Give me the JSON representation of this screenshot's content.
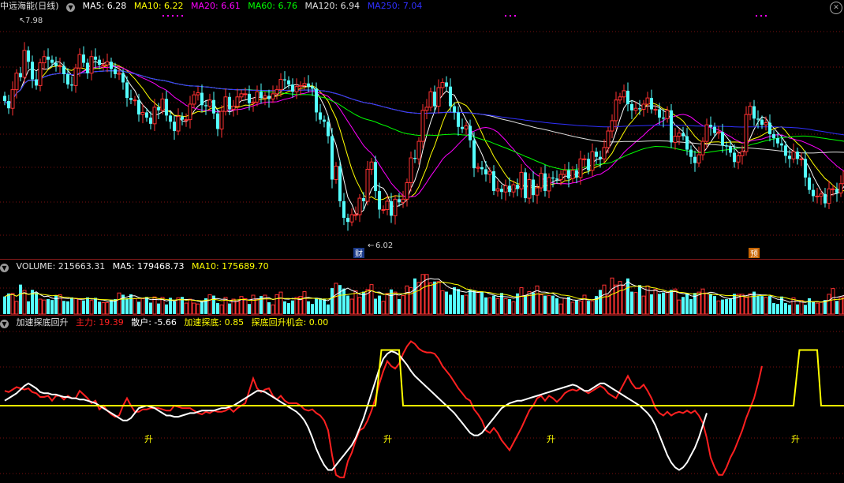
{
  "price_legend": {
    "title": "中远海能(日线)",
    "ma5_label": "MA5: 6.28",
    "ma10_label": "MA10: 6.22",
    "ma20_label": "MA20: 6.61",
    "ma60_label": "MA60: 6.76",
    "ma120_label": "MA120: 6.94",
    "ma250_label": "MA250: 7.04"
  },
  "volume_legend": {
    "volume_label": "VOLUME: 215663.31",
    "ma5_label": "MA5: 179468.73",
    "ma10_label": "MA10: 175689.70"
  },
  "indicator_legend": {
    "name": "加速探底回升",
    "main_label": "主力: 19.39",
    "retail_label": "散户: -5.66",
    "accel_label": "加速探底: 0.85",
    "chance_label": "探底回升机会: 0.00"
  },
  "annotations": {
    "high_label": "7.98",
    "low_label": "6.02",
    "badge_cai": "财",
    "badge_yu": "预",
    "rise_marker": "升"
  },
  "colors": {
    "background": "#000000",
    "up": "#ff3232",
    "down": "#54ffff",
    "ma5": "#ffffff",
    "ma10": "#ffff00",
    "ma20": "#ff00ff",
    "ma60": "#00ff00",
    "ma120": "#e0e0e0",
    "ma250": "#3030ff",
    "grid": "#7a1010",
    "main": "#ff2020",
    "retail": "#ffffff",
    "zero_line": "#ffff00"
  },
  "chart_data": [
    {
      "type": "candlestick",
      "title": "中远海能(日线)",
      "ylim": [
        5.9,
        8.1
      ],
      "x": [
        1,
        2,
        3,
        4,
        5,
        6,
        7,
        8,
        9,
        10,
        11,
        12,
        13,
        14,
        15,
        16,
        17,
        18,
        19,
        20,
        21,
        22,
        23,
        24,
        25,
        26,
        27,
        28,
        29,
        30,
        31,
        32,
        33,
        34,
        35,
        36,
        37,
        38,
        39,
        40,
        41,
        42,
        43,
        44,
        45,
        46,
        47,
        48,
        49,
        50,
        51,
        52,
        53,
        54,
        55,
        56,
        57,
        58,
        59,
        60,
        61,
        62,
        63,
        64,
        65,
        66,
        67,
        68,
        69,
        70,
        71,
        72,
        73,
        74,
        75,
        76,
        77,
        78,
        79,
        80,
        81,
        82,
        83,
        84,
        85,
        86,
        87,
        88,
        89,
        90,
        91,
        92,
        93,
        94,
        95,
        96,
        97,
        98,
        99,
        100,
        101,
        102,
        103,
        104,
        105,
        106,
        107,
        108,
        109,
        110,
        111,
        112,
        113,
        114,
        115,
        116,
        117,
        118,
        119,
        120,
        121,
        122,
        123,
        124,
        125,
        126,
        127,
        128,
        129,
        130,
        131,
        132,
        133,
        134,
        135,
        136,
        137,
        138,
        139,
        140,
        141,
        142,
        143,
        144,
        145,
        146,
        147,
        148,
        149,
        150,
        151,
        152,
        153,
        154,
        155,
        156,
        157,
        158,
        159,
        160,
        161,
        162,
        163,
        164,
        165,
        166,
        167,
        168,
        169,
        170,
        171,
        172,
        173,
        174,
        175,
        176,
        177,
        178,
        179,
        180,
        181,
        182,
        183,
        184,
        185,
        186,
        187,
        188,
        189,
        190,
        191,
        192,
        193,
        194,
        195,
        196,
        197,
        198,
        199,
        200,
        201,
        202,
        203,
        204,
        205,
        206,
        207,
        208,
        209,
        210,
        211,
        212,
        213
      ],
      "close": [
        7.29,
        7.22,
        7.4,
        7.56,
        7.52,
        7.78,
        7.67,
        7.5,
        7.44,
        7.66,
        7.72,
        7.69,
        7.66,
        7.63,
        7.63,
        7.55,
        7.45,
        7.44,
        7.61,
        7.74,
        7.66,
        7.56,
        7.72,
        7.69,
        7.64,
        7.64,
        7.67,
        7.6,
        7.55,
        7.56,
        7.47,
        7.32,
        7.3,
        7.3,
        7.16,
        7.18,
        7.13,
        7.07,
        7.23,
        7.2,
        7.31,
        7.15,
        7.09,
        7.0,
        7.14,
        7.11,
        7.11,
        7.26,
        7.35,
        7.37,
        7.25,
        7.24,
        7.3,
        7.17,
        7.02,
        7.19,
        7.33,
        7.21,
        7.24,
        7.33,
        7.36,
        7.36,
        7.27,
        7.28,
        7.38,
        7.32,
        7.34,
        7.31,
        7.36,
        7.4,
        7.5,
        7.49,
        7.45,
        7.38,
        7.43,
        7.44,
        7.46,
        7.43,
        7.41,
        7.18,
        7.11,
        7.09,
        6.95,
        6.53,
        6.66,
        6.32,
        6.16,
        6.12,
        6.19,
        6.19,
        6.35,
        6.32,
        6.63,
        6.7,
        6.42,
        6.24,
        6.24,
        6.32,
        6.18,
        6.34,
        6.31,
        6.34,
        6.5,
        6.74,
        6.73,
        6.9,
        7.2,
        7.23,
        7.38,
        7.24,
        7.42,
        7.47,
        7.43,
        7.24,
        7.18,
        7.04,
        7.02,
        7.05,
        6.91,
        6.64,
        6.65,
        6.63,
        6.58,
        6.61,
        6.42,
        6.44,
        6.41,
        6.47,
        6.41,
        6.48,
        6.44,
        6.6,
        6.35,
        6.53,
        6.38,
        6.45,
        6.59,
        6.42,
        6.55,
        6.54,
        6.53,
        6.58,
        6.62,
        6.54,
        6.62,
        6.55,
        6.73,
        6.73,
        6.62,
        6.8,
        6.75,
        6.73,
        6.84,
        7.0,
        7.1,
        7.3,
        7.33,
        7.39,
        7.26,
        7.2,
        7.22,
        7.21,
        7.26,
        7.32,
        7.21,
        7.21,
        7.13,
        7.12,
        7.2,
        6.89,
        6.95,
        6.98,
        6.95,
        6.82,
        6.75,
        6.69,
        6.77,
        6.9,
        7.06,
        7.04,
        6.98,
        6.99,
        6.86,
        6.85,
        6.79,
        6.7,
        6.76,
        6.8,
        7.16,
        7.24,
        7.12,
        7.11,
        7.06,
        7.08,
        6.97,
        6.93,
        6.88,
        6.86,
        6.76,
        6.73,
        6.8,
        6.73,
        6.73,
        6.55,
        6.43,
        6.37,
        6.37,
        6.39,
        6.3,
        6.44,
        6.44,
        6.4,
        6.49,
        6.61,
        6.73
      ],
      "series_names": [
        "MA5",
        "MA10",
        "MA20",
        "MA60",
        "MA120",
        "MA250"
      ]
    },
    {
      "type": "bar",
      "title": "VOLUME",
      "values": [
        40,
        47,
        47,
        29,
        67,
        54,
        29,
        55,
        49,
        34,
        32,
        34,
        32,
        42,
        44,
        30,
        29,
        38,
        36,
        35,
        31,
        38,
        31,
        37,
        28,
        26,
        26,
        33,
        34,
        48,
        44,
        36,
        45,
        35,
        28,
        35,
        39,
        26,
        39,
        24,
        38,
        22,
        37,
        29,
        37,
        39,
        25,
        34,
        25,
        23,
        30,
        36,
        44,
        42,
        25,
        21,
        38,
        24,
        34,
        29,
        40,
        35,
        23,
        43,
        33,
        41,
        43,
        27,
        21,
        44,
        50,
        29,
        25,
        31,
        38,
        40,
        51,
        29,
        23,
        37,
        36,
        34,
        22,
        59,
        70,
        66,
        58,
        42,
        34,
        53,
        38,
        51,
        56,
        67,
        35,
        42,
        29,
        47,
        56,
        50,
        34,
        42,
        64,
        60,
        81,
        72,
        90,
        90,
        71,
        74,
        74,
        53,
        51,
        44,
        61,
        57,
        43,
        43,
        56,
        54,
        50,
        50,
        38,
        37,
        42,
        35,
        48,
        35,
        34,
        28,
        47,
        60,
        43,
        51,
        49,
        64,
        44,
        42,
        42,
        42,
        36,
        23,
        36,
        39,
        27,
        32,
        29,
        43,
        30,
        30,
        41,
        55,
        66,
        43,
        82,
        66,
        74,
        65,
        81,
        51,
        49,
        66,
        41,
        64,
        45,
        56,
        46,
        49,
        49,
        55,
        57,
        32,
        39,
        47,
        34,
        48,
        50,
        57,
        48,
        45,
        41,
        30,
        33,
        34,
        36,
        46,
        45,
        45,
        38,
        46,
        51,
        41,
        41,
        38,
        41,
        25,
        23,
        40,
        25,
        21,
        37,
        22,
        31,
        21,
        36,
        28,
        25,
        27,
        32,
        45,
        58,
        30,
        37,
        42,
        20,
        32
      ]
    },
    {
      "type": "line",
      "title": "加速探底回升",
      "ylim": [
        -60,
        60
      ],
      "series": [
        {
          "name": "主力",
          "values": [
            12,
            11,
            13,
            15,
            14,
            13,
            14,
            11,
            10,
            7,
            7,
            8,
            4,
            8,
            8,
            5,
            8,
            6,
            6,
            12,
            9,
            6,
            2,
            4,
            -3,
            0,
            -4,
            -7,
            -9,
            -8,
            0,
            6,
            0,
            -5,
            -5,
            -3,
            -3,
            -2,
            -2,
            -2,
            -3,
            -4,
            -4,
            0,
            -1,
            -2,
            -2,
            -2,
            -4,
            -6,
            -7,
            -5,
            -6,
            -4,
            -5,
            -5,
            -4,
            -2,
            -5,
            -2,
            0,
            2,
            12,
            22,
            14,
            11,
            13,
            14,
            8,
            5,
            8,
            4,
            2,
            2,
            2,
            0,
            -3,
            -4,
            -3,
            -6,
            -8,
            -12,
            -20,
            -40,
            -56,
            -58,
            -58,
            -45,
            -38,
            -28,
            -20,
            -18,
            -12,
            -4,
            6,
            18,
            28,
            36,
            32,
            30,
            34,
            42,
            48,
            52,
            50,
            46,
            44,
            43,
            43,
            42,
            38,
            32,
            28,
            24,
            19,
            14,
            10,
            6,
            4,
            -3,
            -7,
            -12,
            -20,
            -22,
            -18,
            -22,
            -28,
            -32,
            -36,
            -30,
            -24,
            -18,
            -11,
            -4,
            0,
            6,
            8,
            4,
            8,
            6,
            3,
            6,
            10,
            12,
            13,
            12,
            14,
            12,
            10,
            12,
            14,
            16,
            14,
            10,
            8,
            6,
            12,
            18,
            24,
            18,
            14,
            14,
            17,
            12,
            6,
            -2,
            -6,
            -8,
            -5,
            -8,
            -6,
            -5,
            -6,
            -4,
            -6,
            -4,
            -8,
            -14,
            -26,
            -42,
            -50,
            -56,
            -56,
            -50,
            -42,
            -36,
            -28,
            -20,
            -10,
            -2,
            6,
            18,
            32
          ]
        },
        {
          "name": "散户",
          "values": [
            4,
            6,
            8,
            10,
            13,
            16,
            18,
            16,
            14,
            11,
            10,
            10,
            9,
            9,
            8,
            7,
            7,
            6,
            6,
            5,
            5,
            4,
            3,
            2,
            0,
            -2,
            -4,
            -6,
            -8,
            -10,
            -12,
            -12,
            -10,
            -6,
            -2,
            -1,
            0,
            -1,
            -2,
            -4,
            -6,
            -8,
            -8,
            -9,
            -9,
            -8,
            -7,
            -6,
            -6,
            -5,
            -4,
            -4,
            -4,
            -4,
            -3,
            -2,
            -2,
            -1,
            0,
            2,
            4,
            6,
            8,
            10,
            12,
            12,
            11,
            9,
            7,
            5,
            3,
            1,
            -1,
            -3,
            -5,
            -8,
            -12,
            -18,
            -26,
            -35,
            -42,
            -48,
            -52,
            -52,
            -48,
            -44,
            -40,
            -36,
            -32,
            -26,
            -18,
            -10,
            0,
            10,
            20,
            30,
            38,
            42,
            44,
            43,
            41,
            37,
            33,
            28,
            24,
            21,
            18,
            15,
            12,
            9,
            6,
            3,
            0,
            -3,
            -6,
            -10,
            -14,
            -18,
            -22,
            -24,
            -24,
            -22,
            -18,
            -14,
            -10,
            -6,
            -2,
            0,
            2,
            3,
            4,
            4,
            5,
            6,
            7,
            8,
            9,
            10,
            11,
            12,
            13,
            14,
            15,
            16,
            17,
            16,
            14,
            12,
            12,
            14,
            16,
            18,
            18,
            16,
            14,
            12,
            10,
            8,
            6,
            4,
            2,
            0,
            -3,
            -6,
            -10,
            -16,
            -24,
            -32,
            -40,
            -46,
            -50,
            -52,
            -50,
            -46,
            -40,
            -34,
            -26,
            -16,
            -6
          ]
        },
        {
          "name": "加速探底",
          "values": []
        },
        {
          "name": "探底回升机会",
          "values": []
        }
      ]
    }
  ]
}
